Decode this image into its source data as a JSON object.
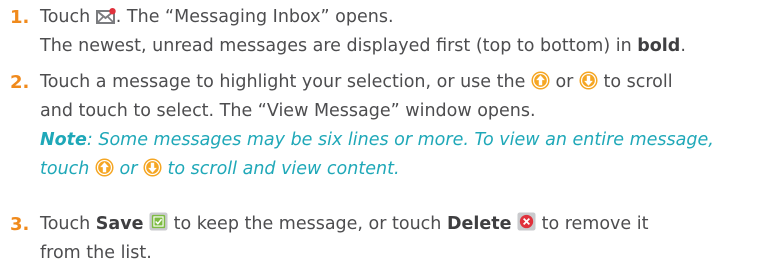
{
  "steps": [
    {
      "number": "1.",
      "l1_a": "Touch ",
      "l1_b": ". The “Messaging Inbox” opens.",
      "l2_a": "The newest, unread messages are displayed first (top to bottom) in ",
      "l2_bold": "bold",
      "l2_b": "."
    },
    {
      "number": "2.",
      "l1_a": "Touch a message to highlight your selection, or use the ",
      "l1_or": " or ",
      "l1_b": " to scroll",
      "l2": "and touch to select. The “View Message” window opens.",
      "note_label": "Note",
      "note_l1": ": Some messages may be six lines or more. To view an entire message,",
      "note_l2_a": "touch ",
      "note_l2_or": " or ",
      "note_l2_b": " to scroll and view content."
    },
    {
      "number": "3.",
      "l1_a": "Touch ",
      "save_label": "Save",
      "l1_mid": " to keep the message, or touch ",
      "delete_label": "Delete",
      "l1_b": " to remove it",
      "l2": "from the list."
    }
  ],
  "icons": {
    "mail": "envelope-alert-icon",
    "up": "scroll-up-icon",
    "down": "scroll-down-icon",
    "save": "save-icon",
    "delete": "delete-icon"
  },
  "colors": {
    "number": "#f08a1c",
    "text": "#4d4d4f",
    "note": "#1fa8b8",
    "arrow": "#f5a623",
    "save_icon": "#7dbb42",
    "delete_icon": "#e0313c"
  }
}
